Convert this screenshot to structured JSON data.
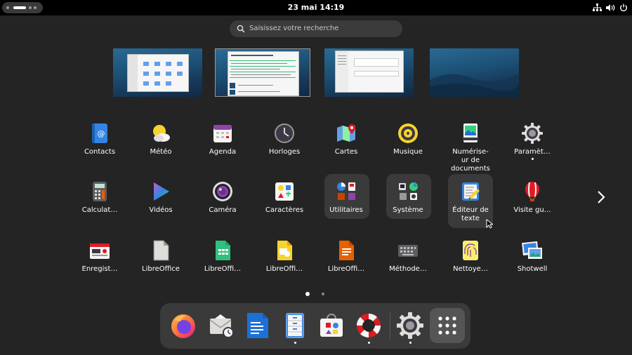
{
  "topbar": {
    "clock": "23 mai  14:19",
    "tray_icons": [
      "network-icon",
      "volume-icon",
      "power-icon"
    ]
  },
  "search": {
    "placeholder": "Saisissez votre recherche"
  },
  "workspaces": [
    {
      "name": "workspace-1",
      "content": "file-manager"
    },
    {
      "name": "workspace-2",
      "content": "text-editor"
    },
    {
      "name": "workspace-3",
      "content": "settings"
    },
    {
      "name": "workspace-4",
      "content": "empty"
    }
  ],
  "apps": {
    "row1": [
      {
        "label": "Contacts",
        "icon": "contacts-icon"
      },
      {
        "label": "Météo",
        "icon": "weather-icon"
      },
      {
        "label": "Agenda",
        "icon": "calendar-icon"
      },
      {
        "label": "Horloges",
        "icon": "clock-icon"
      },
      {
        "label": "Cartes",
        "icon": "maps-icon"
      },
      {
        "label": "Musique",
        "icon": "music-icon"
      },
      {
        "label": "Numérise-\nur de\ndocuments",
        "icon": "scanner-icon"
      },
      {
        "label": "Paramèt…",
        "icon": "settings-icon",
        "running": true
      }
    ],
    "row2": [
      {
        "label": "Calculat…",
        "icon": "calculator-icon"
      },
      {
        "label": "Vidéos",
        "icon": "videos-icon"
      },
      {
        "label": "Caméra",
        "icon": "camera-icon"
      },
      {
        "label": "Caractères",
        "icon": "characters-icon"
      },
      {
        "label": "Utilitaires",
        "icon": "utilities-folder-icon",
        "folder": true
      },
      {
        "label": "Système",
        "icon": "system-folder-icon",
        "folder": true
      },
      {
        "label": "Éditeur de\ntexte",
        "icon": "text-editor-icon",
        "highlighted": true
      },
      {
        "label": "Visite gu…",
        "icon": "tour-icon"
      }
    ],
    "row3": [
      {
        "label": "Enregist…",
        "icon": "recorder-icon"
      },
      {
        "label": "LibreOffice",
        "icon": "libreoffice-icon"
      },
      {
        "label": "LibreOffi…",
        "icon": "libreoffice-calc-icon"
      },
      {
        "label": "LibreOffi…",
        "icon": "libreoffice-impress-icon"
      },
      {
        "label": "LibreOffi…",
        "icon": "libreoffice-draw-icon"
      },
      {
        "label": "Méthode…",
        "icon": "keyboard-icon"
      },
      {
        "label": "Nettoye…",
        "icon": "cleaner-icon"
      },
      {
        "label": "Shotwell",
        "icon": "shotwell-icon"
      }
    ]
  },
  "pager": {
    "pages": 2,
    "current": 1
  },
  "dock": [
    {
      "name": "firefox",
      "icon": "firefox-icon"
    },
    {
      "name": "evolution",
      "icon": "mail-icon"
    },
    {
      "name": "writer",
      "icon": "libreoffice-writer-icon"
    },
    {
      "name": "files",
      "icon": "files-icon",
      "running": true
    },
    {
      "name": "software",
      "icon": "software-icon"
    },
    {
      "name": "help",
      "icon": "help-icon",
      "running": true
    },
    {
      "name": "settings",
      "icon": "settings-icon",
      "running": true
    },
    {
      "name": "show-apps",
      "icon": "app-grid-icon"
    }
  ],
  "colors": {
    "background": "#242424",
    "topbar": "#000000",
    "dock": "#3a3a3a",
    "accent": "#3584e4"
  }
}
